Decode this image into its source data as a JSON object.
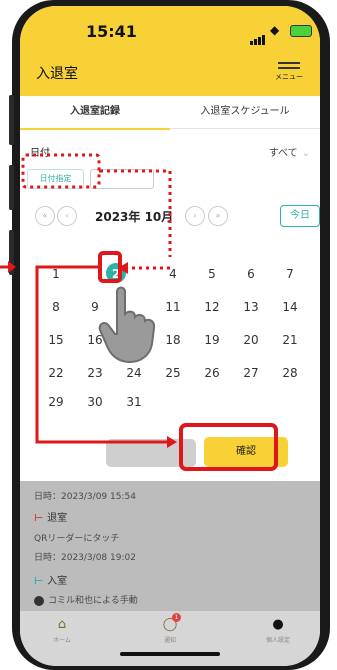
{
  "status": {
    "time": "15:41"
  },
  "header": {
    "title": "入退室",
    "menu_label": "メニュー"
  },
  "tabs": [
    {
      "label": "入退室記録",
      "active": true
    },
    {
      "label": "入退室スケジュール",
      "active": false
    }
  ],
  "filter": {
    "date_label": "日付",
    "range_value": "すべて"
  },
  "mode_buttons": [
    {
      "label": "日付指定",
      "selected": true
    },
    {
      "label": "",
      "selected": false
    }
  ],
  "calendar": {
    "month_label": "2023年  10月",
    "today_label": "今日",
    "weekdays": [
      "",
      "",
      "",
      "",
      "",
      "",
      ""
    ],
    "weeks": [
      [
        "1",
        "2",
        "",
        "4",
        "5",
        "6",
        "7"
      ],
      [
        "8",
        "9",
        "",
        "11",
        "12",
        "13",
        "14"
      ],
      [
        "15",
        "16",
        "17",
        "18",
        "19",
        "20",
        "21"
      ],
      [
        "22",
        "23",
        "24",
        "25",
        "26",
        "27",
        "28"
      ],
      [
        "29",
        "30",
        "31",
        "",
        "",
        "",
        ""
      ]
    ],
    "selected_day": "2"
  },
  "actions": {
    "reset_label": "",
    "confirm_label": "確認"
  },
  "log": {
    "entries": [
      {
        "text": "日時：2023/3/09 15:54"
      },
      {
        "text": "退室",
        "type": "exit"
      },
      {
        "text": "QRリーダーにタッチ"
      },
      {
        "text": "日時：2023/3/08 19:02"
      },
      {
        "text": "入室",
        "type": "enter"
      },
      {
        "text": "コミル和也による手動"
      }
    ]
  },
  "bottom_nav": [
    {
      "label": "ホーム",
      "icon": "home-icon"
    },
    {
      "label": "通知",
      "icon": "bell-icon",
      "badge": "1"
    },
    {
      "label": "個人設定",
      "icon": "person-icon"
    }
  ],
  "colors": {
    "accent_yellow": "#f7d135",
    "teal": "#2bb3a8",
    "highlight_red": "#e0161b"
  }
}
